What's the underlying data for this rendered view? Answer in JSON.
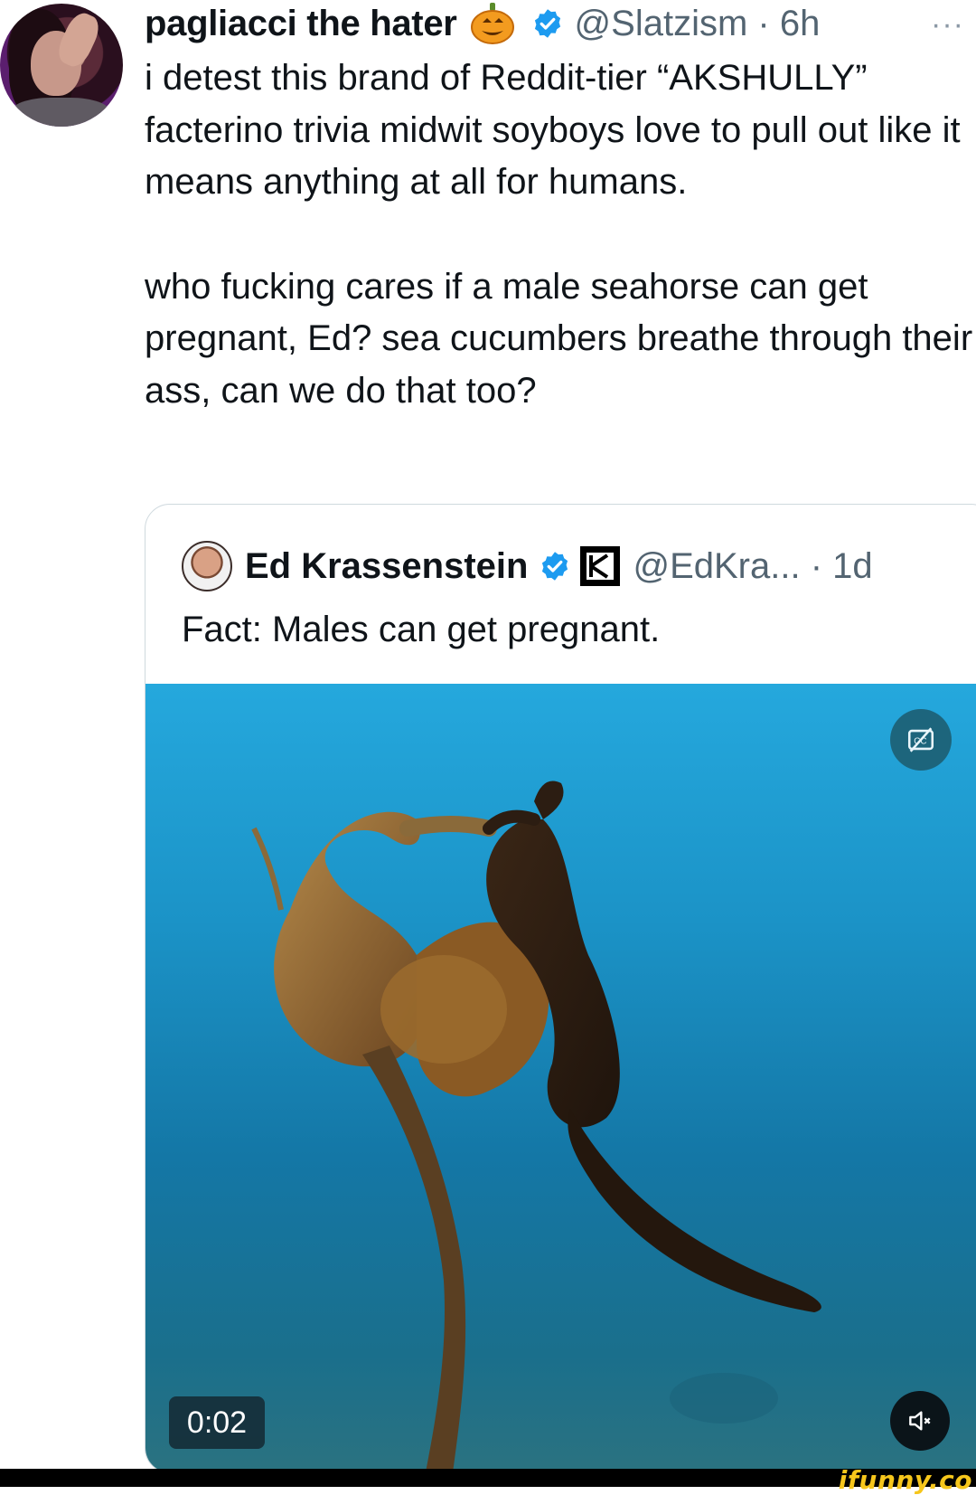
{
  "tweet": {
    "author_name": "pagliacci the hater",
    "author_handle": "@Slatzism",
    "time": "6h",
    "handle_time": "@Slatzism · 6h",
    "more_label": "···",
    "paragraph_1": "i detest this brand of Reddit-tier “AKSHULLY” facterino trivia midwit soyboys love to pull out like it means anything at all for humans.",
    "paragraph_2": "who fucking cares if a male seahorse can get pregnant, Ed? sea cucumbers breathe through their ass, can we do that too?",
    "avatar_icon": "profile-photo",
    "pumpkin_icon": "jack-o-lantern-icon",
    "verified_icon": "verified-badge-icon"
  },
  "quoted_tweet": {
    "author_name": "Ed Krassenstein",
    "handle_time": "@EdKra... · 1d",
    "text": "Fact: Males can get pregnant.",
    "video": {
      "duration": "0:02",
      "cc_icon": "captions-off-icon",
      "mute_icon": "muted-speaker-icon"
    }
  },
  "watermark": "ifunny.co",
  "colors": {
    "text": "#0f1419",
    "secondary": "#536471",
    "verified": "#1d9bf0",
    "watermark": "#f6c61b"
  }
}
